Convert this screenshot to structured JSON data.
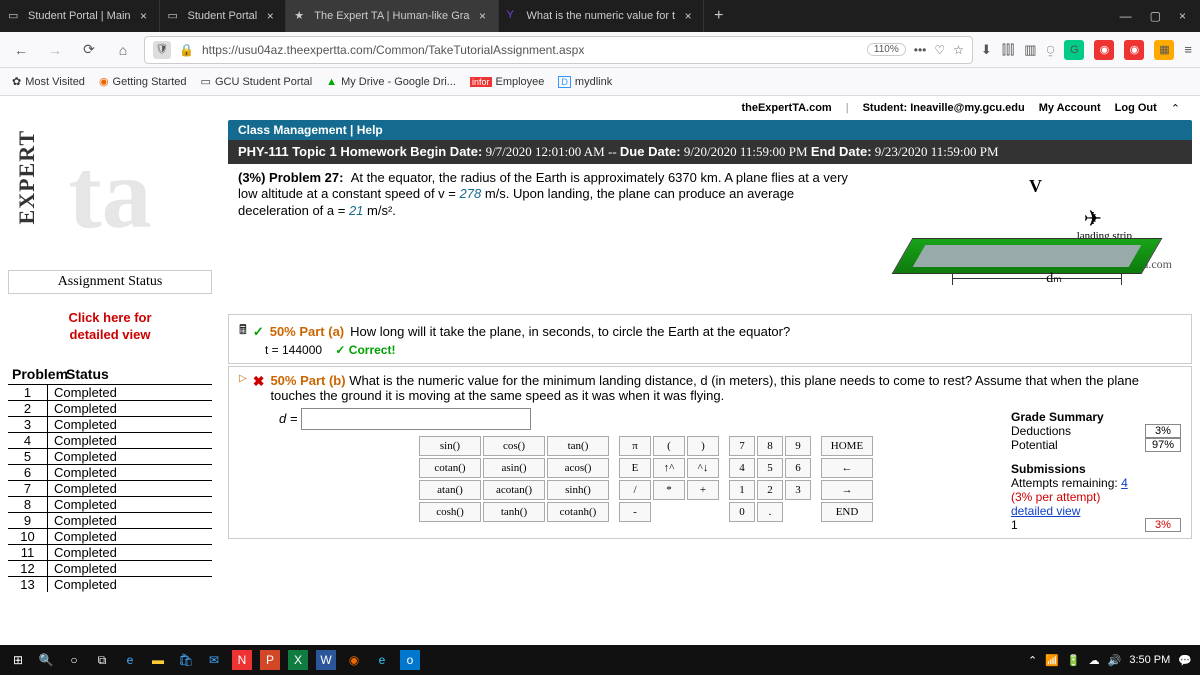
{
  "browser": {
    "tabs": [
      {
        "label": "Student Portal | Main"
      },
      {
        "label": "Student Portal"
      },
      {
        "label": "The Expert TA | Human-like Gra"
      },
      {
        "label": "What is the numeric value for t"
      }
    ],
    "url": "https://usu04az.theexpertta.com/Common/TakeTutorialAssignment.aspx",
    "zoom": "110%",
    "bookmarks": [
      "Most Visited",
      "Getting Started",
      "GCU Student Portal",
      "My Drive - Google Dri...",
      "Employee",
      "mydlink"
    ]
  },
  "header": {
    "site": "theExpertTA.com",
    "student": "Student: Ineaville@my.gcu.edu",
    "account": "My Account",
    "logout": "Log Out"
  },
  "sidebar": {
    "assignment_status": "Assignment Status",
    "click_here_1": "Click here for",
    "click_here_2": "detailed view",
    "ps_problem": "Problem",
    "ps_status": "Status",
    "problems": [
      {
        "n": "1",
        "s": "Completed"
      },
      {
        "n": "2",
        "s": "Completed"
      },
      {
        "n": "3",
        "s": "Completed"
      },
      {
        "n": "4",
        "s": "Completed"
      },
      {
        "n": "5",
        "s": "Completed"
      },
      {
        "n": "6",
        "s": "Completed"
      },
      {
        "n": "7",
        "s": "Completed"
      },
      {
        "n": "8",
        "s": "Completed"
      },
      {
        "n": "9",
        "s": "Completed"
      },
      {
        "n": "10",
        "s": "Completed"
      },
      {
        "n": "11",
        "s": "Completed"
      },
      {
        "n": "12",
        "s": "Completed"
      },
      {
        "n": "13",
        "s": "Completed"
      }
    ]
  },
  "content": {
    "class_mgmt": "Class Management   |   Help",
    "phy_line": "PHY-111 Topic 1 Homework Begin Date: 9/7/2020 12:01:00 AM -- Due Date: 9/20/2020 11:59:00 PM End Date: 9/23/2020 11:59:00 PM",
    "problem_label": "(3%)  Problem 27:",
    "problem_text_1": "At the equator, the radius of the Earth is approximately 6370 km. A plane flies at a very low altitude at a constant speed of v = ",
    "problem_v": "278",
    "problem_text_2": " m/s. Upon landing, the plane can produce an average deceleration of a = ",
    "problem_a": "21",
    "problem_text_3": " m/s².",
    "landing_strip": "landing strip",
    "d_label": "dₘ",
    "v_label": "V",
    "copyright": "©theexpertta.com",
    "part_a_pct": "50% Part (a)",
    "part_a_q": "How long will it take the plane, in seconds, to circle the Earth at the equator?",
    "part_a_ans": "t = 144000",
    "part_a_correct": "✓ Correct!",
    "part_b_pct": "50% Part (b)",
    "part_b_q": "What is the numeric value for the minimum landing distance, d (in meters), this plane needs to come to rest? Assume that when the plane touches the ground it is moving at the same speed as it was when it was flying.",
    "d_equals": "d =",
    "keypad": {
      "func": [
        "sin()",
        "cos()",
        "tan()",
        "cotan()",
        "asin()",
        "acos()",
        "atan()",
        "acotan()",
        "sinh()",
        "cosh()",
        "tanh()",
        "cotanh()"
      ],
      "sym": [
        "π",
        "(",
        ")",
        "E",
        "↑^",
        "^↓",
        "/",
        "*",
        "+",
        "-"
      ],
      "num": [
        "7",
        "8",
        "9",
        "4",
        "5",
        "6",
        "1",
        "2",
        "3",
        "0",
        "."
      ],
      "ctrl": [
        "HOME",
        "←",
        "→",
        "END"
      ]
    },
    "grade": {
      "title": "Grade Summary",
      "deductions_label": "Deductions",
      "deductions": "3%",
      "potential_label": "Potential",
      "potential": "97%",
      "subs_title": "Submissions",
      "attempts": "Attempts remaining:",
      "attempts_n": "4",
      "per_attempt": "(3% per attempt)",
      "detailed": "detailed view",
      "row1_a": "1",
      "row1_b": "3%"
    }
  },
  "taskbar": {
    "time": "3:50 PM"
  }
}
